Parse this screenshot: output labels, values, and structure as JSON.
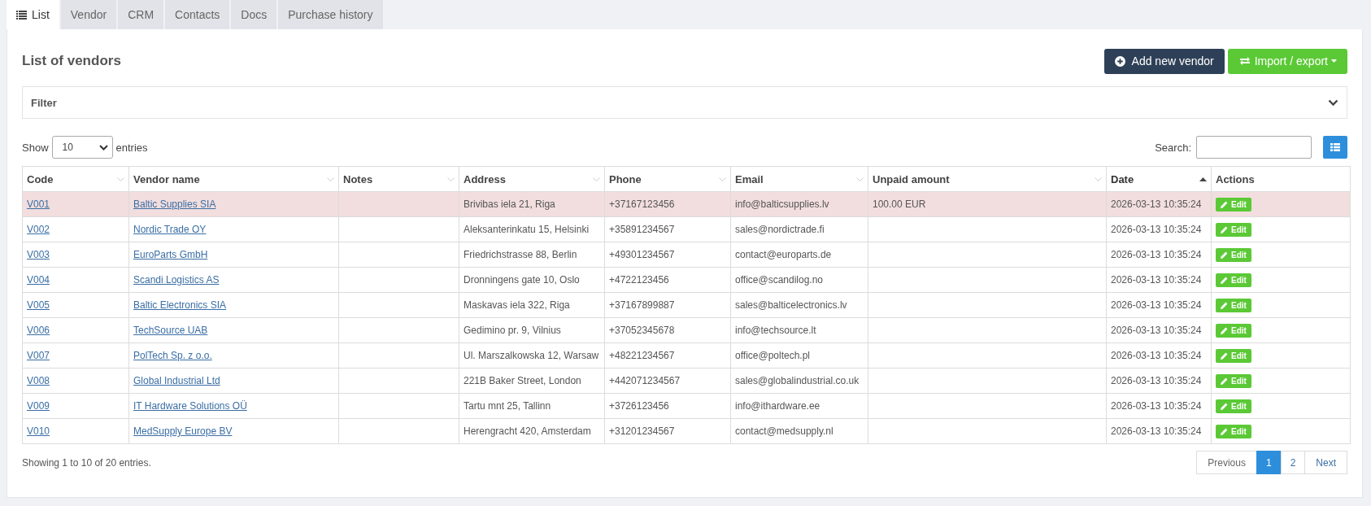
{
  "tabs": [
    {
      "label": "List",
      "selected": true,
      "icon": true
    },
    {
      "label": "Vendor",
      "selected": false
    },
    {
      "label": "CRM",
      "selected": false
    },
    {
      "label": "Contacts",
      "selected": false
    },
    {
      "label": "Docs",
      "selected": false
    },
    {
      "label": "Purchase history",
      "selected": false
    }
  ],
  "heading": "List of vendors",
  "buttons": [
    {
      "label": "Add new vendor",
      "kind": "primary"
    },
    {
      "label": "Import / export",
      "kind": "dropdown"
    }
  ],
  "filter": {
    "label": "Filter",
    "expanded": false
  },
  "length": {
    "before": "Show",
    "value": "10",
    "after": "entries"
  },
  "search": {
    "label": "Search:"
  },
  "table": {
    "columns": [
      {
        "label": "Code",
        "sortable": true,
        "sorted": false
      },
      {
        "label": "Vendor name",
        "sortable": true,
        "sorted": false
      },
      {
        "label": "Notes",
        "sortable": true,
        "sorted": false
      },
      {
        "label": "Address",
        "sortable": true,
        "sorted": false
      },
      {
        "label": "Phone",
        "sortable": true,
        "sorted": false
      },
      {
        "label": "Email",
        "sortable": true,
        "sorted": false
      },
      {
        "label": "Unpaid amount",
        "sortable": true,
        "sorted": false
      },
      {
        "label": "Date",
        "sortable": true,
        "sorted": true
      },
      {
        "label": "Actions",
        "sortable": false,
        "sorted": false
      }
    ],
    "rows": [
      {
        "highlighted": true,
        "code": "V001",
        "name": "Baltic Supplies SIA",
        "address": "Brivibas iela 21, Riga",
        "phone": "+37167123456",
        "email": "info@balticsupplies.lv",
        "unpaid": "100.00 EUR",
        "date": "2026-03-13 10:35:24",
        "action": "Edit"
      },
      {
        "highlighted": false,
        "code": "V002",
        "name": "Nordic Trade OY",
        "address": "Aleksanterinkatu 15, Helsinki",
        "phone": "+35891234567",
        "email": "sales@nordictrade.fi",
        "date": "2026-03-13 10:35:24",
        "action": "Edit"
      },
      {
        "highlighted": false,
        "code": "V003",
        "name": "EuroParts GmbH",
        "address": "Friedrichstrasse 88, Berlin",
        "phone": "+49301234567",
        "email": "contact@europarts.de",
        "date": "2026-03-13 10:35:24",
        "action": "Edit"
      },
      {
        "highlighted": false,
        "code": "V004",
        "name": "Scandi Logistics AS",
        "address": "Dronningens gate 10, Oslo",
        "phone": "+4722123456",
        "email": "office@scandilog.no",
        "date": "2026-03-13 10:35:24",
        "action": "Edit"
      },
      {
        "highlighted": false,
        "code": "V005",
        "name": "Baltic Electronics SIA",
        "address": "Maskavas iela 322, Riga",
        "phone": "+37167899887",
        "email": "sales@balticelectronics.lv",
        "date": "2026-03-13 10:35:24",
        "action": "Edit"
      },
      {
        "highlighted": false,
        "code": "V006",
        "name": "TechSource UAB",
        "address": "Gedimino pr. 9, Vilnius",
        "phone": "+37052345678",
        "email": "info@techsource.lt",
        "date": "2026-03-13 10:35:24",
        "action": "Edit"
      },
      {
        "highlighted": false,
        "code": "V007",
        "name": "PolTech Sp. z o.o.",
        "address": "Ul. Marszalkowska 12, Warsaw",
        "phone": "+48221234567",
        "email": "office@poltech.pl",
        "date": "2026-03-13 10:35:24",
        "action": "Edit"
      },
      {
        "highlighted": false,
        "code": "V008",
        "name": "Global Industrial Ltd",
        "address": "221B Baker Street, London",
        "phone": "+442071234567",
        "email": "sales@globalindustrial.co.uk",
        "date": "2026-03-13 10:35:24",
        "action": "Edit"
      },
      {
        "highlighted": false,
        "code": "V009",
        "name": "IT Hardware Solutions OÜ",
        "address": "Tartu mnt 25, Tallinn",
        "phone": "+3726123456",
        "email": "info@ithardware.ee",
        "date": "2026-03-13 10:35:24",
        "action": "Edit"
      },
      {
        "highlighted": false,
        "code": "V010",
        "name": "MedSupply Europe BV",
        "address": "Herengracht 420, Amsterdam",
        "phone": "+31201234567",
        "email": "contact@medsupply.nl",
        "date": "2026-03-13 10:35:24",
        "action": "Edit"
      }
    ]
  },
  "info": "Showing 1 to 10 of 20 entries.",
  "pagination": [
    {
      "label": "Previous",
      "kind": "prev",
      "disabled": true,
      "selected": false
    },
    {
      "label": "1",
      "kind": "page",
      "disabled": false,
      "selected": true
    },
    {
      "label": "2",
      "kind": "page",
      "disabled": false,
      "selected": false
    },
    {
      "label": "Next",
      "kind": "next",
      "disabled": false,
      "selected": false
    }
  ]
}
